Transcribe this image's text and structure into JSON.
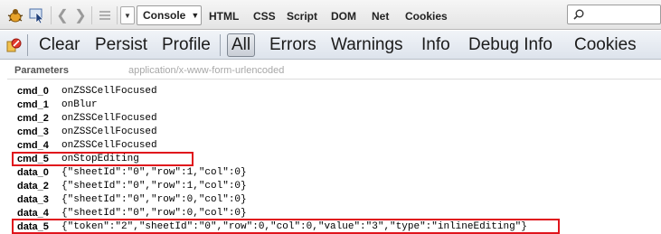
{
  "toolbar": {
    "console_tab_label": "Console",
    "tabs": [
      "HTML",
      "CSS",
      "Script",
      "DOM",
      "Net",
      "Cookies"
    ],
    "search_placeholder": ""
  },
  "filterbar": {
    "actions": [
      "Clear",
      "Persist",
      "Profile"
    ],
    "filters": [
      "All",
      "Errors",
      "Warnings",
      "Info",
      "Debug Info",
      "Cookies"
    ],
    "active_filter": "All"
  },
  "params": {
    "title": "Parameters",
    "content_type": "application/x-www-form-urlencoded",
    "rows": [
      {
        "key": "cmd_0",
        "value": "onZSSCellFocused"
      },
      {
        "key": "cmd_1",
        "value": "onBlur"
      },
      {
        "key": "cmd_2",
        "value": "onZSSCellFocused"
      },
      {
        "key": "cmd_3",
        "value": "onZSSCellFocused"
      },
      {
        "key": "cmd_4",
        "value": "onZSSCellFocused"
      },
      {
        "key": "cmd_5",
        "value": "onStopEditing"
      },
      {
        "key": "data_0",
        "value": "{\"sheetId\":\"0\",\"row\":1,\"col\":0}"
      },
      {
        "key": "data_2",
        "value": "{\"sheetId\":\"0\",\"row\":1,\"col\":0}"
      },
      {
        "key": "data_3",
        "value": "{\"sheetId\":\"0\",\"row\":0,\"col\":0}"
      },
      {
        "key": "data_4",
        "value": "{\"sheetId\":\"0\",\"row\":0,\"col\":0}"
      },
      {
        "key": "data_5",
        "value": "{\"token\":\"2\",\"sheetId\":\"0\",\"row\":0,\"col\":0,\"value\":\"3\",\"type\":\"inlineEditing\"}"
      }
    ]
  },
  "colors": {
    "highlight": "#e0141c"
  }
}
